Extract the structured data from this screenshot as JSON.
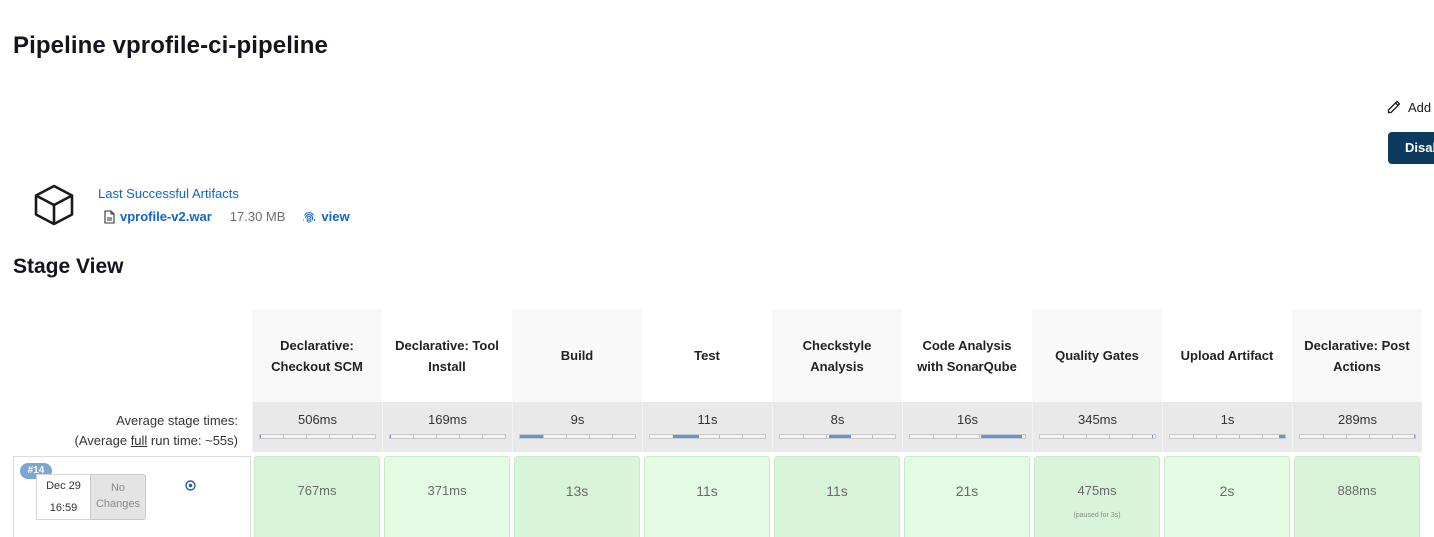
{
  "page": {
    "title": "Pipeline vprofile-ci-pipeline",
    "edit_description_label": "Add",
    "disable_button_label": "Disab"
  },
  "artifacts": {
    "title": "Last Successful Artifacts",
    "file_name": "vprofile-v2.war",
    "file_size": "17.30 MB",
    "view_label": "view",
    "icons": {
      "box": "box-icon",
      "file": "file-icon",
      "fingerprint": "fingerprint-icon"
    }
  },
  "stage_view": {
    "title": "Stage View",
    "avg_label_line1": "Average stage times:",
    "avg_label_prefix": "(Average ",
    "avg_label_full": "full",
    "avg_label_suffix": " run time: ~55s)",
    "colors": {
      "success_light": "#e3fbe3",
      "success_dark": "#d9f5d9",
      "bar_fill": "#6495d6",
      "badge": "#7ba6d3"
    },
    "stages": [
      {
        "name": "Declarative: Checkout SCM",
        "avg": "506ms",
        "bar": {
          "from": 0.0,
          "to": 0.0
        },
        "run": "767ms"
      },
      {
        "name": "Declarative: Tool Install",
        "avg": "169ms",
        "bar": {
          "from": 0.0,
          "to": 0.0
        },
        "run": "371ms"
      },
      {
        "name": "Build",
        "avg": "9s",
        "bar": {
          "from": 0.0,
          "to": 0.2
        },
        "run": "13s"
      },
      {
        "name": "Test",
        "avg": "11s",
        "bar": {
          "from": 0.2,
          "to": 0.43
        },
        "run": "11s"
      },
      {
        "name": "Checkstyle Analysis",
        "avg": "8s",
        "bar": {
          "from": 0.43,
          "to": 0.62
        },
        "run": "11s"
      },
      {
        "name": "Code Analysis with SonarQube",
        "avg": "16s",
        "bar": {
          "from": 0.62,
          "to": 0.97
        },
        "run": "21s"
      },
      {
        "name": "Quality Gates",
        "avg": "345ms",
        "bar": {
          "from": 0.97,
          "to": 0.985
        },
        "run": "475ms",
        "note": "(paused for 3s)"
      },
      {
        "name": "Upload Artifact",
        "avg": "1s",
        "bar": {
          "from": 0.95,
          "to": 1.0
        },
        "run": "2s"
      },
      {
        "name": "Declarative: Post Actions",
        "avg": "289ms",
        "bar": {
          "from": 1.0,
          "to": 1.0
        },
        "run": "888ms"
      }
    ],
    "build": {
      "number": "#14",
      "date": "Dec 29",
      "time": "16:59",
      "changes": "No Changes"
    }
  }
}
